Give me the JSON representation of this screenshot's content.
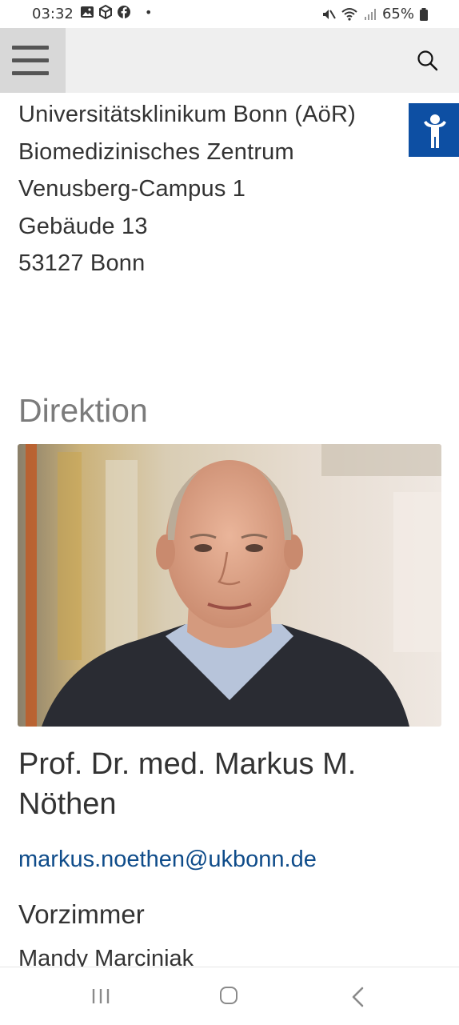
{
  "status_bar": {
    "time": "03:32",
    "battery": "65%",
    "left_icons": [
      "gallery-icon",
      "cube-icon",
      "facebook-icon"
    ],
    "right_icons": [
      "mute-icon",
      "wifi-icon",
      "signal-icon",
      "battery-icon"
    ]
  },
  "header": {
    "menu_icon": "hamburger-menu-icon",
    "search_icon": "search-icon"
  },
  "address": {
    "line1": "Universitätsklinikum Bonn (AöR)",
    "line2": "Biomedizinisches Zentrum",
    "line3": "Venusberg-Campus 1",
    "line4": "Gebäude 13",
    "line5": "53127 Bonn"
  },
  "accessibility": {
    "icon": "accessibility-person-icon",
    "color": "#0d4fa3"
  },
  "direction": {
    "title": "Direktion",
    "name": "Prof. Dr. med. Markus M. Nöthen",
    "email": "markus.noethen@ukbonn.de",
    "office_label": "Vorzimmer",
    "assistant": "Mandy Marciniak"
  },
  "colors": {
    "link": "#0f4c8a",
    "heading_gray": "#7b7b7b"
  }
}
